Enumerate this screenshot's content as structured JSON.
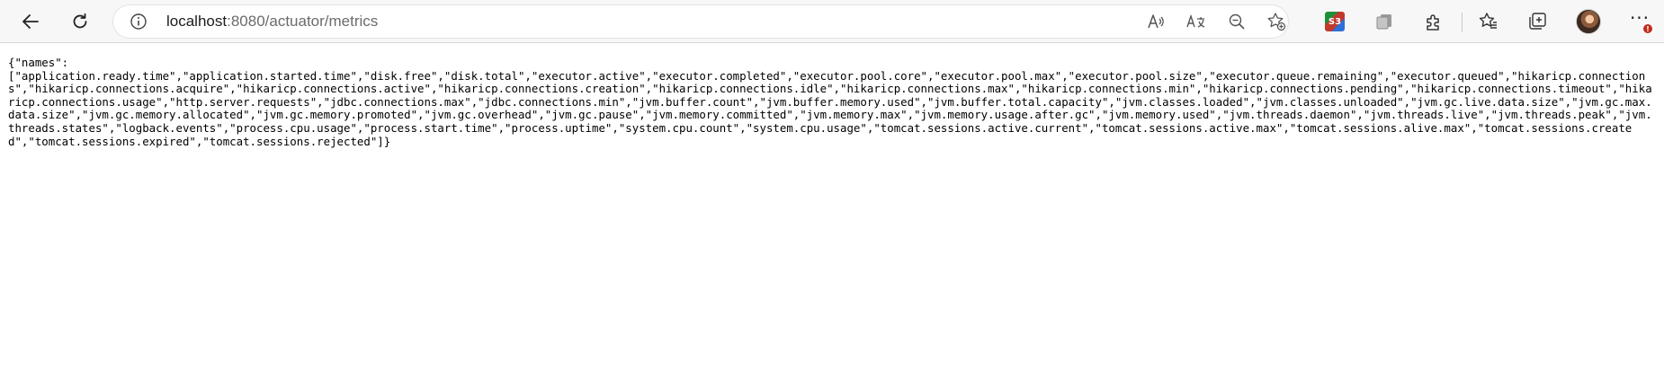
{
  "browser": {
    "address_bar": {
      "url_host": "localhost",
      "url_path": ":8080/actuator/metrics"
    },
    "icons": {
      "back": "back-arrow-icon",
      "refresh": "refresh-icon",
      "info": "info-icon",
      "read_aloud": "read-aloud-icon",
      "translate": "translate-icon",
      "zoom_out": "zoom-out-icon",
      "add_favorite": "add-favorite-icon",
      "extension_s3": "s3-extension-icon",
      "collections_ext": "collections-extension-icon",
      "extensions": "extensions-puzzle-icon",
      "favorites": "favorites-icon",
      "collections": "collections-icon",
      "profile": "profile-avatar",
      "menu": "more-menu-icon"
    },
    "s3_badge": "S3",
    "menu_label": "···",
    "alert_badge": "!",
    "colors": {
      "toolbar_bg": "#f7f7f7",
      "alert": "#c42b1c"
    }
  },
  "page": {
    "json_text": "{\"names\":\n[\"application.ready.time\",\"application.started.time\",\"disk.free\",\"disk.total\",\"executor.active\",\"executor.completed\",\"executor.pool.core\",\"executor.pool.max\",\"executor.pool.size\",\"executor.queue.remaining\",\"executor.queued\",\"hikaricp.connections\",\"hikaricp.connections.acquire\",\"hikaricp.connections.active\",\"hikaricp.connections.creation\",\"hikaricp.connections.idle\",\"hikaricp.connections.max\",\"hikaricp.connections.min\",\"hikaricp.connections.pending\",\"hikaricp.connections.timeout\",\"hikaricp.connections.usage\",\"http.server.requests\",\"jdbc.connections.max\",\"jdbc.connections.min\",\"jvm.buffer.count\",\"jvm.buffer.memory.used\",\"jvm.buffer.total.capacity\",\"jvm.classes.loaded\",\"jvm.classes.unloaded\",\"jvm.gc.live.data.size\",\"jvm.gc.max.data.size\",\"jvm.gc.memory.allocated\",\"jvm.gc.memory.promoted\",\"jvm.gc.overhead\",\"jvm.gc.pause\",\"jvm.memory.committed\",\"jvm.memory.max\",\"jvm.memory.usage.after.gc\",\"jvm.memory.used\",\"jvm.threads.daemon\",\"jvm.threads.live\",\"jvm.threads.peak\",\"jvm.threads.states\",\"logback.events\",\"process.cpu.usage\",\"process.start.time\",\"process.uptime\",\"system.cpu.count\",\"system.cpu.usage\",\"tomcat.sessions.active.current\",\"tomcat.sessions.active.max\",\"tomcat.sessions.alive.max\",\"tomcat.sessions.created\",\"tomcat.sessions.expired\",\"tomcat.sessions.rejected\"]}"
  }
}
